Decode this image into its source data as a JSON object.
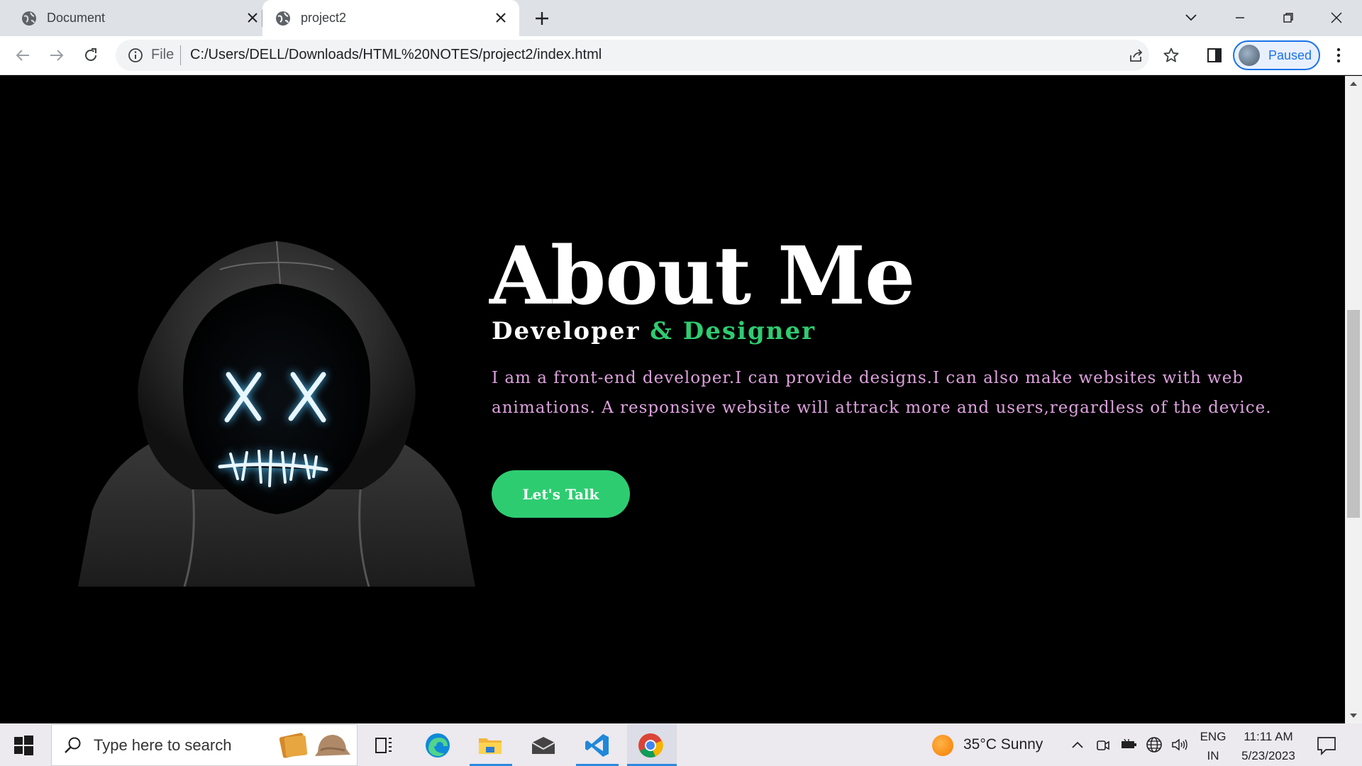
{
  "browser": {
    "tabs": [
      {
        "title": "Document",
        "active": false
      },
      {
        "title": "project2",
        "active": true
      }
    ],
    "address": {
      "scheme_label": "File",
      "url": "C:/Users/DELL/Downloads/HTML%20NOTES/project2/index.html"
    },
    "profile_label": "Paused"
  },
  "page": {
    "title": "About Me",
    "subtitle_white": "Developer",
    "subtitle_green": "& Designer",
    "bio": "I am a front-end developer.I can provide designs.I can also make websites with web animations. A responsive website will attrack more and users,regardless of the device.",
    "cta_label": "Let's Talk",
    "colors": {
      "background": "#000000",
      "accent": "#2ecc71",
      "bio_text": "#dda0dd"
    }
  },
  "taskbar": {
    "search_placeholder": "Type here to search",
    "weather": "35°C  Sunny",
    "lang_line1": "ENG",
    "lang_line2": "IN",
    "time": "11:11 AM",
    "date": "5/23/2023",
    "pinned_apps": [
      "task-view-icon",
      "edge-icon",
      "file-explorer-icon",
      "mail-icon",
      "vscode-icon",
      "chrome-icon"
    ]
  }
}
